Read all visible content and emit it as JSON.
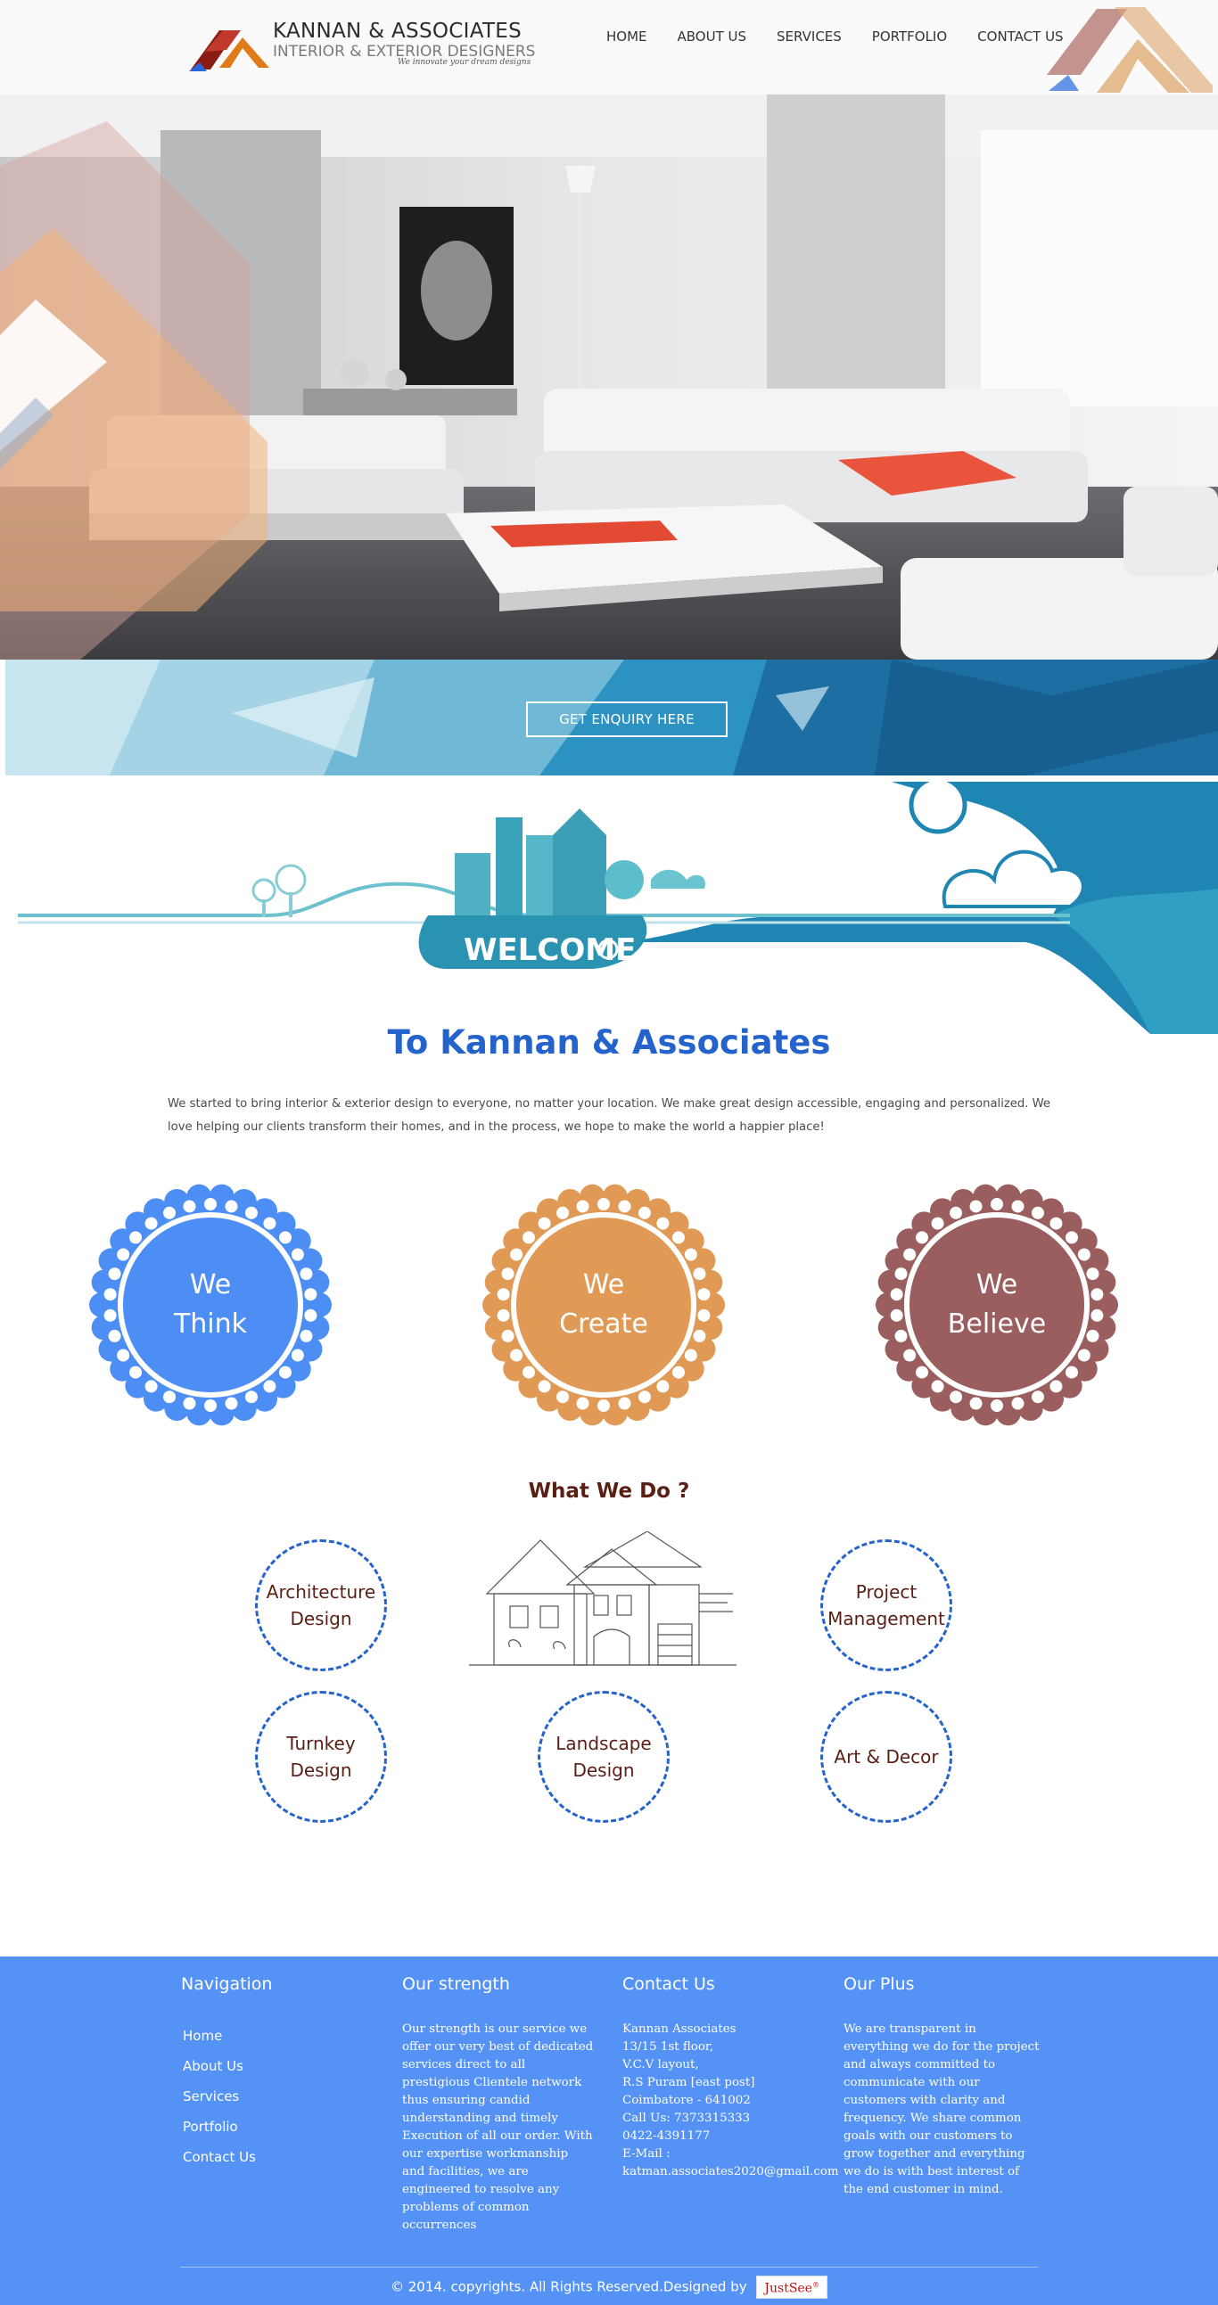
{
  "header": {
    "brand_name": "KANNAN & ASSOCIATES",
    "brand_sub": "INTERIOR & EXTERIOR DESIGNERS",
    "tagline": "We innovate your dream designs",
    "nav": [
      {
        "label": "HOME"
      },
      {
        "label": "ABOUT US"
      },
      {
        "label": "SERVICES"
      },
      {
        "label": "PORTFOLIO"
      },
      {
        "label": "CONTACT US"
      }
    ]
  },
  "enquiry": {
    "button_label": "GET ENQUIRY HERE"
  },
  "welcome": {
    "word": "WELCOME"
  },
  "intro": {
    "title": "To Kannan & Associates",
    "text": "We started to bring interior & exterior design to everyone, no matter your location. We make great design accessible, engaging and personalized. We love helping our clients transform their homes, and in the process, we hope to make the world a happier place!"
  },
  "values": [
    {
      "line1": "We",
      "line2": "Think",
      "color": "#4d8ef5"
    },
    {
      "line1": "We",
      "line2": "Create",
      "color": "#e09a55"
    },
    {
      "line1": "We",
      "line2": "Believe",
      "color": "#9a5e5e"
    }
  ],
  "services": {
    "title": "What We Do ?",
    "items": [
      {
        "label": "Architecture Design"
      },
      {
        "label": "Project Management"
      },
      {
        "label": "Turnkey Design"
      },
      {
        "label": "Landscape Design"
      },
      {
        "label": "Art & Decor"
      }
    ]
  },
  "footer": {
    "navigation": {
      "heading": "Navigation",
      "links": [
        {
          "label": "Home"
        },
        {
          "label": "About Us"
        },
        {
          "label": "Services"
        },
        {
          "label": "Portfolio"
        },
        {
          "label": "Contact Us"
        }
      ]
    },
    "strength": {
      "heading": "Our strength",
      "text": "Our strength is our service we offer our very best of dedicated services direct to all prestigious Clientele network thus ensuring candid understanding and timely Execution of all our order. With our expertise workmanship and facilities, we are engineered to resolve any problems of common occurrences"
    },
    "contact": {
      "heading": "Contact Us",
      "lines": "Kannan Associates\n13/15 1st floor,\nV.C.V layout,\nR.S Puram [east post]\nCoimbatore - 641002\nCall Us: 7373315333\n            0422-4391177\nE-Mail :\nkatman.associates2020@gmail.com"
    },
    "plus": {
      "heading": "Our Plus",
      "text": "We are transparent in everything we do for the project and always committed to communicate with our customers with clarity and frequency. We share common goals with our customers to grow together and everything we do is with best interest of the end customer in mind."
    },
    "copyright": "© 2014. copyrights. All Rights Reserved.Designed by",
    "designer": "JustSee",
    "designer_mark": "®"
  },
  "colors": {
    "brand_blue": "#2462cc",
    "footer_blue": "#5592f5",
    "service_text": "#5a1f14"
  }
}
